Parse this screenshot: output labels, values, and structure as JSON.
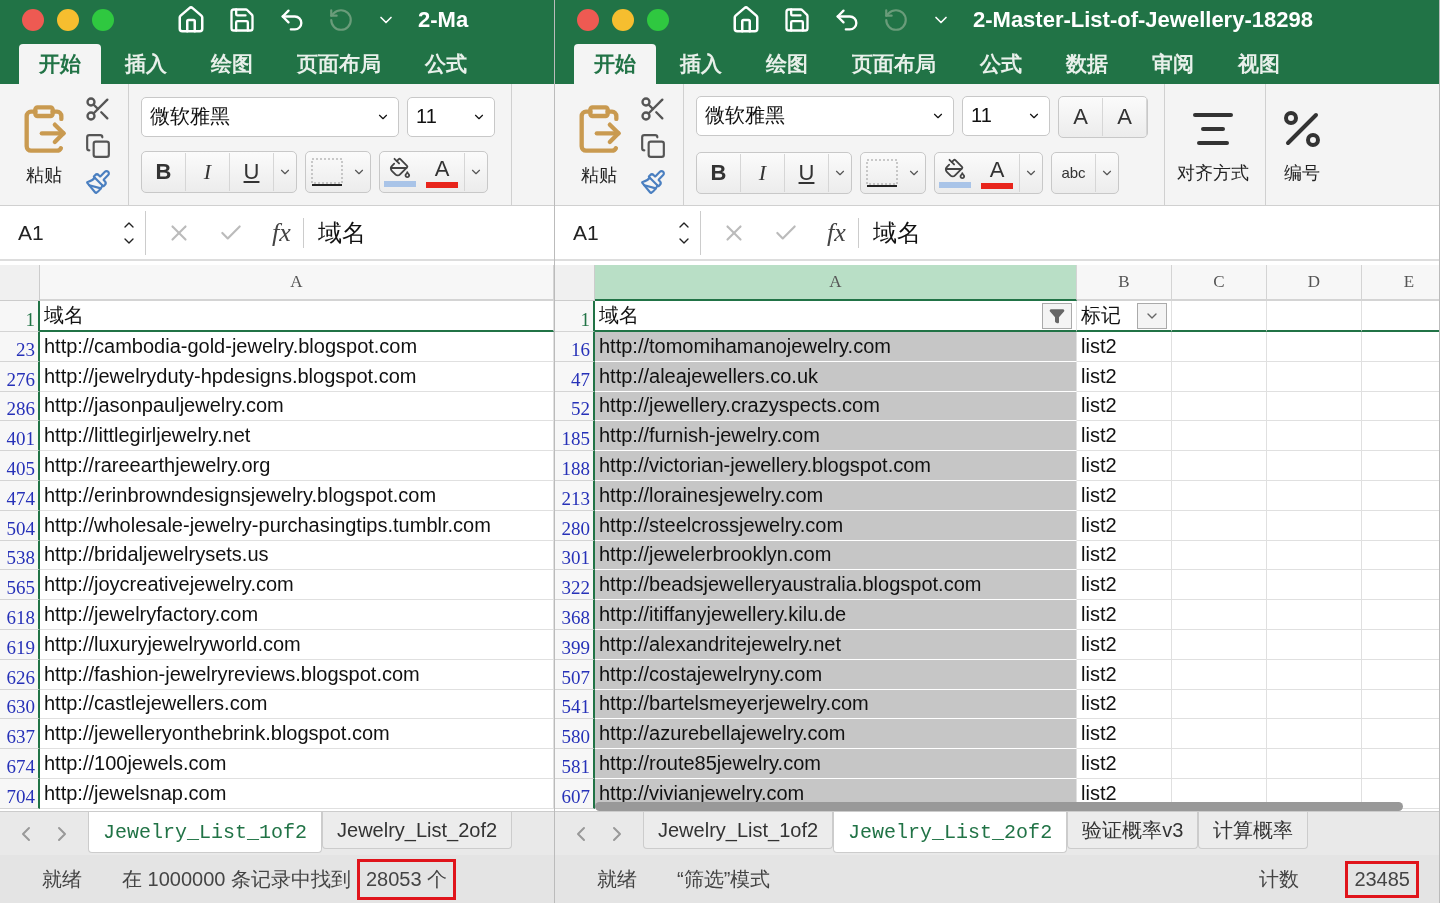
{
  "windows": [
    {
      "title": "2-Ma",
      "scrollbar_shown": false,
      "ribbon_tabs": [
        {
          "label": "开始",
          "selected": true
        },
        {
          "label": "插入",
          "selected": false
        },
        {
          "label": "绘图",
          "selected": false
        },
        {
          "label": "页面布局",
          "selected": false
        },
        {
          "label": "公式",
          "selected": false
        }
      ],
      "ribbon_groups": [
        {
          "kind": "clipboard",
          "label": "粘贴"
        },
        {
          "kind": "font",
          "font": "微软雅黑",
          "size": "11",
          "style_labels": [
            "B",
            "I",
            "U"
          ],
          "color_label": "A"
        }
      ],
      "name_box": "A1",
      "fx": "fx",
      "formula": "域名",
      "columns": [
        {
          "label": "A",
          "selected": false
        }
      ],
      "header_row": {
        "number": "1",
        "cells": [
          {
            "text": "域名"
          }
        ]
      },
      "rows": [
        {
          "number": "23",
          "cells": [
            "http://cambodia-gold-jewelry.blogspot.com"
          ]
        },
        {
          "number": "276",
          "cells": [
            "http://jewelryduty-hpdesigns.blogspot.com"
          ]
        },
        {
          "number": "286",
          "cells": [
            "http://jasonpauljewelry.com"
          ]
        },
        {
          "number": "401",
          "cells": [
            "http://littlegirljewelry.net"
          ]
        },
        {
          "number": "405",
          "cells": [
            "http://rareearthjewelry.org"
          ]
        },
        {
          "number": "474",
          "cells": [
            "http://erinbrowndesignsjewelry.blogspot.com"
          ]
        },
        {
          "number": "504",
          "cells": [
            "http://wholesale-jewelry-purchasingtips.tumblr.com"
          ]
        },
        {
          "number": "538",
          "cells": [
            "http://bridaljewelrysets.us"
          ]
        },
        {
          "number": "565",
          "cells": [
            "http://joycreativejewelry.com"
          ]
        },
        {
          "number": "618",
          "cells": [
            "http://jewelryfactory.com"
          ]
        },
        {
          "number": "619",
          "cells": [
            "http://luxuryjewelryworld.com"
          ]
        },
        {
          "number": "626",
          "cells": [
            "http://fashion-jewelryreviews.blogspot.com"
          ]
        },
        {
          "number": "630",
          "cells": [
            "http://castlejewellers.com"
          ]
        },
        {
          "number": "637",
          "cells": [
            "http://jewelleryonthebrink.blogspot.com"
          ]
        },
        {
          "number": "674",
          "cells": [
            "http://100jewels.com"
          ]
        },
        {
          "number": "704",
          "cells": [
            "http://jewelsnap.com"
          ]
        }
      ],
      "sheet_tabs": [
        {
          "label": "Jewelry_List_1of2",
          "selected": true
        },
        {
          "label": "Jewelry_List_2of2",
          "selected": false
        }
      ],
      "status": {
        "ready": "就绪",
        "message": "在 1000000 条记录中找到",
        "highlight": "28053 个"
      }
    },
    {
      "title": "2-Master-List-of-Jewellery-18298",
      "scrollbar_shown": true,
      "ribbon_tabs": [
        {
          "label": "开始",
          "selected": true
        },
        {
          "label": "插入",
          "selected": false
        },
        {
          "label": "绘图",
          "selected": false
        },
        {
          "label": "页面布局",
          "selected": false
        },
        {
          "label": "公式",
          "selected": false
        },
        {
          "label": "数据",
          "selected": false
        },
        {
          "label": "审阅",
          "selected": false
        },
        {
          "label": "视图",
          "selected": false
        }
      ],
      "ribbon_groups": [
        {
          "kind": "clipboard",
          "label": "粘贴"
        },
        {
          "kind": "font",
          "font": "微软雅黑",
          "size": "11",
          "style_labels": [
            "B",
            "I",
            "U"
          ],
          "color_label": "A",
          "grow_label": "A",
          "shrink_label": "A",
          "wrap_label": "abc"
        },
        {
          "kind": "align",
          "label": "对齐方式"
        },
        {
          "kind": "number",
          "label": "编号"
        }
      ],
      "name_box": "A1",
      "fx": "fx",
      "formula": "域名",
      "columns": [
        {
          "label": "A",
          "selected": true
        },
        {
          "label": "B",
          "selected": false
        },
        {
          "label": "C",
          "selected": false
        },
        {
          "label": "D",
          "selected": false
        },
        {
          "label": "E",
          "selected": false
        }
      ],
      "header_row": {
        "number": "1",
        "cells": [
          {
            "text": "域名",
            "filter_active": true
          },
          {
            "text": "标记",
            "filter_active": false
          }
        ]
      },
      "rows": [
        {
          "number": "16",
          "cells": [
            "http://tomomihamanojewelry.com",
            "list2"
          ]
        },
        {
          "number": "47",
          "cells": [
            "http://aleajewellers.co.uk",
            "list2"
          ]
        },
        {
          "number": "52",
          "cells": [
            "http://jewellery.crazyspects.com",
            "list2"
          ]
        },
        {
          "number": "185",
          "cells": [
            "http://furnish-jewelry.com",
            "list2"
          ]
        },
        {
          "number": "188",
          "cells": [
            "http://victorian-jewellery.blogspot.com",
            "list2"
          ]
        },
        {
          "number": "213",
          "cells": [
            "http://lorainesjewelry.com",
            "list2"
          ]
        },
        {
          "number": "280",
          "cells": [
            "http://steelcrossjewelry.com",
            "list2"
          ]
        },
        {
          "number": "301",
          "cells": [
            "http://jewelerbrooklyn.com",
            "list2"
          ]
        },
        {
          "number": "322",
          "cells": [
            "http://beadsjewelleryaustralia.blogspot.com",
            "list2"
          ]
        },
        {
          "number": "368",
          "cells": [
            "http://itiffanyjewellery.kilu.de",
            "list2"
          ]
        },
        {
          "number": "399",
          "cells": [
            "http://alexandritejewelry.net",
            "list2"
          ]
        },
        {
          "number": "507",
          "cells": [
            "http://costajewelryny.com",
            "list2"
          ]
        },
        {
          "number": "541",
          "cells": [
            "http://bartelsmeyerjewelry.com",
            "list2"
          ]
        },
        {
          "number": "580",
          "cells": [
            "http://azurebellajewelry.com",
            "list2"
          ]
        },
        {
          "number": "581",
          "cells": [
            "http://route85jewelry.com",
            "list2"
          ]
        },
        {
          "number": "607",
          "cells": [
            "http://vivianjewelry.com",
            "list2"
          ]
        }
      ],
      "sheet_tabs": [
        {
          "label": "Jewelry_List_1of2",
          "selected": false
        },
        {
          "label": "Jewelry_List_2of2",
          "selected": true
        },
        {
          "label": "验证概率v3",
          "selected": false
        },
        {
          "label": "计算概率",
          "selected": false
        }
      ],
      "status": {
        "ready": "就绪",
        "message": "“筛选”模式",
        "count_label": "计数",
        "highlight": "23485"
      }
    }
  ]
}
